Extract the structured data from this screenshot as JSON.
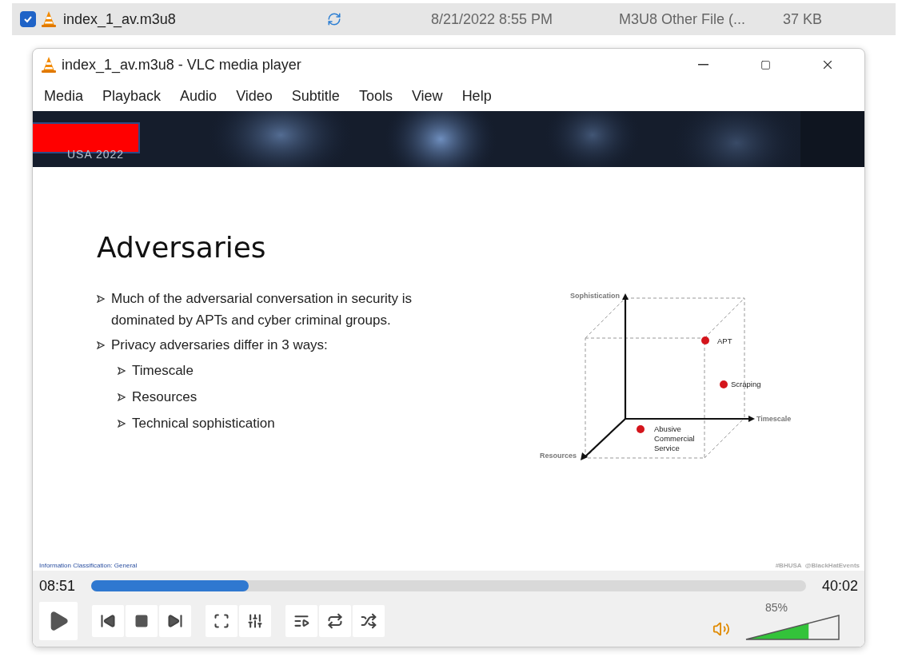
{
  "file_row": {
    "checked": true,
    "name": "index_1_av.m3u8",
    "date": "8/21/2022 8:55 PM",
    "type": "M3U8 Other File (...",
    "size": "37 KB"
  },
  "window": {
    "title": "index_1_av.m3u8 - VLC media player"
  },
  "menu": [
    "Media",
    "Playback",
    "Audio",
    "Video",
    "Subtitle",
    "Tools",
    "View",
    "Help"
  ],
  "slide": {
    "event": "USA 2022",
    "title": "Adversaries",
    "bullets": [
      {
        "text": "Much of the adversarial conversation in security is dominated by APTs and cyber criminal groups."
      },
      {
        "text": "Privacy adversaries differ in 3 ways:",
        "children": [
          {
            "text": "Timescale"
          },
          {
            "text": "Resources"
          },
          {
            "text": "Technical sophistication"
          }
        ]
      }
    ],
    "diagram": {
      "axes": [
        "Sophistication",
        "Timescale",
        "Resources"
      ],
      "points": [
        {
          "label": [
            "APT"
          ],
          "color": "#d4151c"
        },
        {
          "label": [
            "Scraping"
          ],
          "color": "#d4151c"
        },
        {
          "label": [
            "Abusive",
            "Commercial",
            "Service"
          ],
          "color": "#d4151c"
        }
      ]
    },
    "footer_left": "Information Classification: General",
    "footer_right": "#BHUSA  @BlackHatEvents"
  },
  "player": {
    "elapsed": "08:51",
    "total": "40:02",
    "progress": {
      "level": 0.22
    },
    "volume": {
      "reading": "85%",
      "level": 0.68
    }
  }
}
